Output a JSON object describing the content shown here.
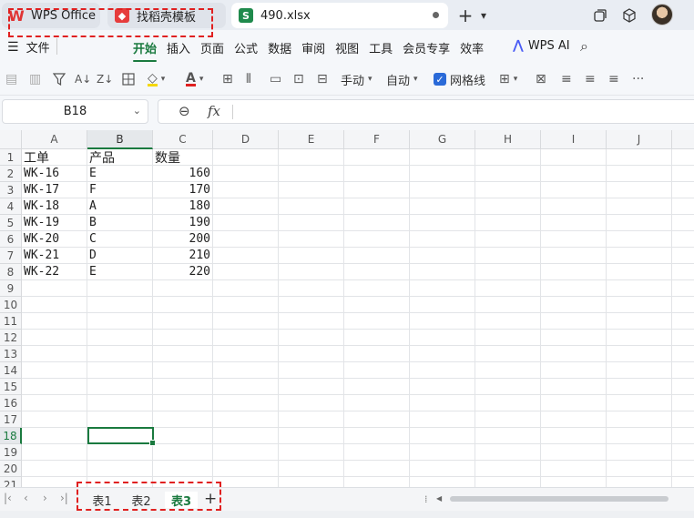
{
  "titlebar": {
    "tabs": [
      {
        "label": "WPS Office",
        "icon": "wps-logo-icon"
      },
      {
        "label": "找稻壳模板",
        "icon": "docer-icon"
      },
      {
        "label": "490.xlsx",
        "icon": "spreadsheet-icon"
      }
    ],
    "new_tab": "+",
    "dropdown": "⌄"
  },
  "menubar": {
    "file_label": "文件",
    "items": [
      "开始",
      "插入",
      "页面",
      "公式",
      "数据",
      "审阅",
      "视图",
      "工具",
      "会员专享",
      "效率"
    ],
    "active": "开始",
    "ai_label": "WPS AI"
  },
  "toolbar": {
    "manual_label": "手动",
    "auto_label": "自动",
    "gridlines_label": "网格线",
    "gridlines_checked": true,
    "more": "···"
  },
  "formula": {
    "cell_ref": "B18",
    "fx": "fx",
    "content": ""
  },
  "grid": {
    "columns": [
      "A",
      "B",
      "C",
      "D",
      "E",
      "F",
      "G",
      "H",
      "I",
      "J"
    ],
    "rows": [
      "1",
      "2",
      "3",
      "4",
      "5",
      "6",
      "7",
      "8",
      "9",
      "10",
      "11",
      "12",
      "13",
      "14",
      "15",
      "16",
      "17",
      "18",
      "19",
      "20",
      "21"
    ],
    "header": [
      "工单",
      "产品",
      "数量"
    ],
    "data": [
      [
        "WK-16",
        "E",
        "160"
      ],
      [
        "WK-17",
        "F",
        "170"
      ],
      [
        "WK-18",
        "A",
        "180"
      ],
      [
        "WK-19",
        "B",
        "190"
      ],
      [
        "WK-20",
        "C",
        "200"
      ],
      [
        "WK-21",
        "D",
        "210"
      ],
      [
        "WK-22",
        "E",
        "220"
      ]
    ],
    "selected": "B18"
  },
  "sheets": {
    "tabs": [
      "表1",
      "表2",
      "表3"
    ],
    "active": "表3",
    "add": "+"
  }
}
